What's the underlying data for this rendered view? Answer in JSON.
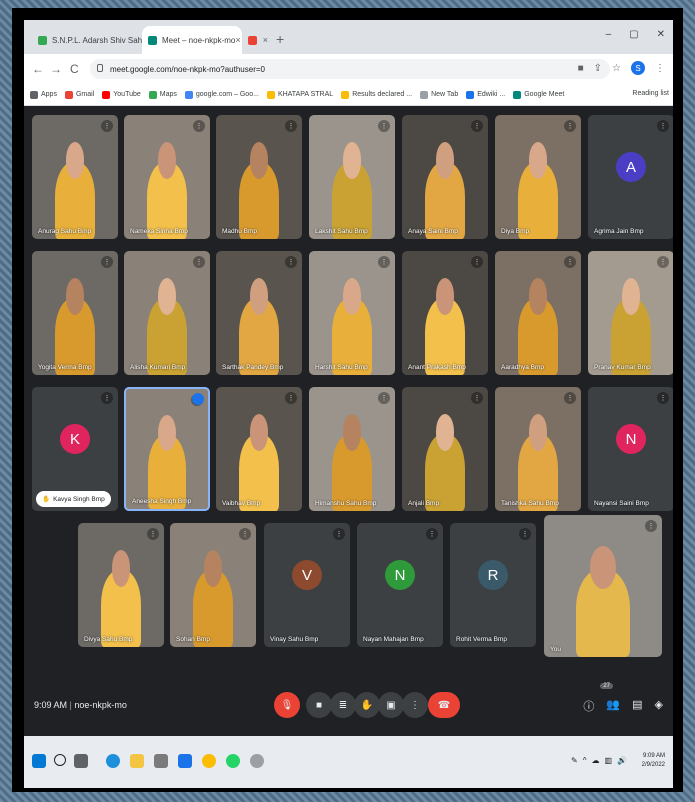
{
  "browser": {
    "tabs": [
      {
        "label": "S.N.P.L. Adarsh Shiv Sahai ...",
        "close": "×"
      },
      {
        "label": "Meet – noe-nkpk-mo",
        "close": "×"
      },
      {
        "label": "",
        "close": "×"
      }
    ],
    "new_tab": "+",
    "window_controls": {
      "minimize": "–",
      "restore": "▢",
      "close": "✕"
    },
    "url": "meet.google.com/noe-nkpk-mo?authuser=0",
    "nav": {
      "back": "←",
      "forward": "→",
      "reload": "C"
    },
    "profile_letter": "S",
    "bookmarks": [
      "Apps",
      "Gmail",
      "YouTube",
      "Maps",
      "google.com – Goo...",
      "KHATAPA STRAL",
      "Results declared ...",
      "New Tab",
      "Edwiki ...",
      "Google Meet"
    ],
    "reading_list": "Reading list"
  },
  "participants": [
    {
      "name": "Anurag Sahu Bmp",
      "avatar": "",
      "avatar_color": ""
    },
    {
      "name": "Nameka Sinha Bmp",
      "avatar": "",
      "avatar_color": ""
    },
    {
      "name": "Madhu Bmp",
      "avatar": "",
      "avatar_color": ""
    },
    {
      "name": "Lakshit Sahu Bmp",
      "avatar": "",
      "avatar_color": ""
    },
    {
      "name": "Anaya Saini Bmp",
      "avatar": "",
      "avatar_color": ""
    },
    {
      "name": "Diya Bmp",
      "avatar": "",
      "avatar_color": ""
    },
    {
      "name": "Agrima Jain Bmp",
      "avatar": "A",
      "avatar_color": "#4a3fc4"
    },
    {
      "name": "Yogita Verma Bmp",
      "avatar": "",
      "avatar_color": ""
    },
    {
      "name": "Alisha Kumari Bmp",
      "avatar": "",
      "avatar_color": ""
    },
    {
      "name": "Sarthak Pandey Bmp",
      "avatar": "",
      "avatar_color": ""
    },
    {
      "name": "Harshit Sahu Bmp",
      "avatar": "",
      "avatar_color": ""
    },
    {
      "name": "Anant Prakash Bmp",
      "avatar": "",
      "avatar_color": ""
    },
    {
      "name": "Aaradhya Bmp",
      "avatar": "",
      "avatar_color": ""
    },
    {
      "name": "Pranav Kumar Bmp",
      "avatar": "",
      "avatar_color": ""
    },
    {
      "name": "Kavya Singh Bmp",
      "avatar": "K",
      "avatar_color": "#e0245e",
      "pill": true
    },
    {
      "name": "Aneesha Singh Bmp",
      "avatar": "",
      "avatar_color": "",
      "self": true
    },
    {
      "name": "Vaibhav Bmp",
      "avatar": "",
      "avatar_color": ""
    },
    {
      "name": "Himanshu Sahu Bmp",
      "avatar": "",
      "avatar_color": ""
    },
    {
      "name": "Anjali Bmp",
      "avatar": "",
      "avatar_color": ""
    },
    {
      "name": "Tanishka Sahu Bmp",
      "avatar": "",
      "avatar_color": ""
    },
    {
      "name": "Nayansi Saini Bmp",
      "avatar": "N",
      "avatar_color": "#e0245e"
    },
    {
      "name": "Divya Sahu Bmp",
      "avatar": "",
      "avatar_color": ""
    },
    {
      "name": "Sohan Bmp",
      "avatar": "",
      "avatar_color": ""
    },
    {
      "name": "Vinay Sahu Bmp",
      "avatar": "V",
      "avatar_color": "#8d4a2e"
    },
    {
      "name": "Nayan Mahajan Bmp",
      "avatar": "N",
      "avatar_color": "#2e9a3a"
    },
    {
      "name": "Rohit Verma Bmp",
      "avatar": "R",
      "avatar_color": "#3a5a6a"
    },
    {
      "name": "You",
      "avatar": "",
      "avatar_color": ""
    }
  ],
  "meeting": {
    "time": "9:09 AM",
    "code": "noe-nkpk-mo",
    "participant_count": "27",
    "controls": [
      "mic-off",
      "camera",
      "captions",
      "raise-hand",
      "present",
      "more",
      "end-call"
    ]
  },
  "taskbar": {
    "time": "9:09 AM",
    "date": "2/9/2022"
  },
  "colors": {
    "meet_bg": "#202124",
    "end_call": "#ea4335",
    "accent": "#1a73e8"
  }
}
